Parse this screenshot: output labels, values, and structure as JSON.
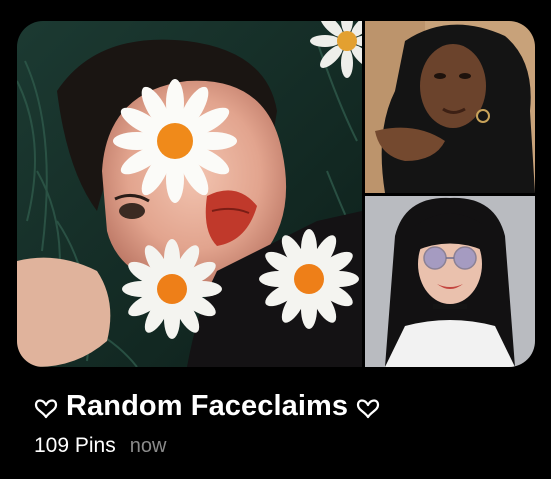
{
  "board": {
    "title": "Random Faceclaims",
    "title_prefix_icon": "heart-outline-icon",
    "title_suffix_icon": "heart-outline-icon",
    "pin_count": "109 Pins",
    "updated": "now"
  },
  "images": [
    {
      "name": "main-photo",
      "description_icon": "photo"
    },
    {
      "name": "top-right-photo",
      "description_icon": "photo"
    },
    {
      "name": "bottom-right-photo",
      "description_icon": "photo"
    }
  ],
  "colors": {
    "background": "#000000",
    "text_primary": "#ffffff",
    "text_secondary": "#8a8a8a"
  }
}
